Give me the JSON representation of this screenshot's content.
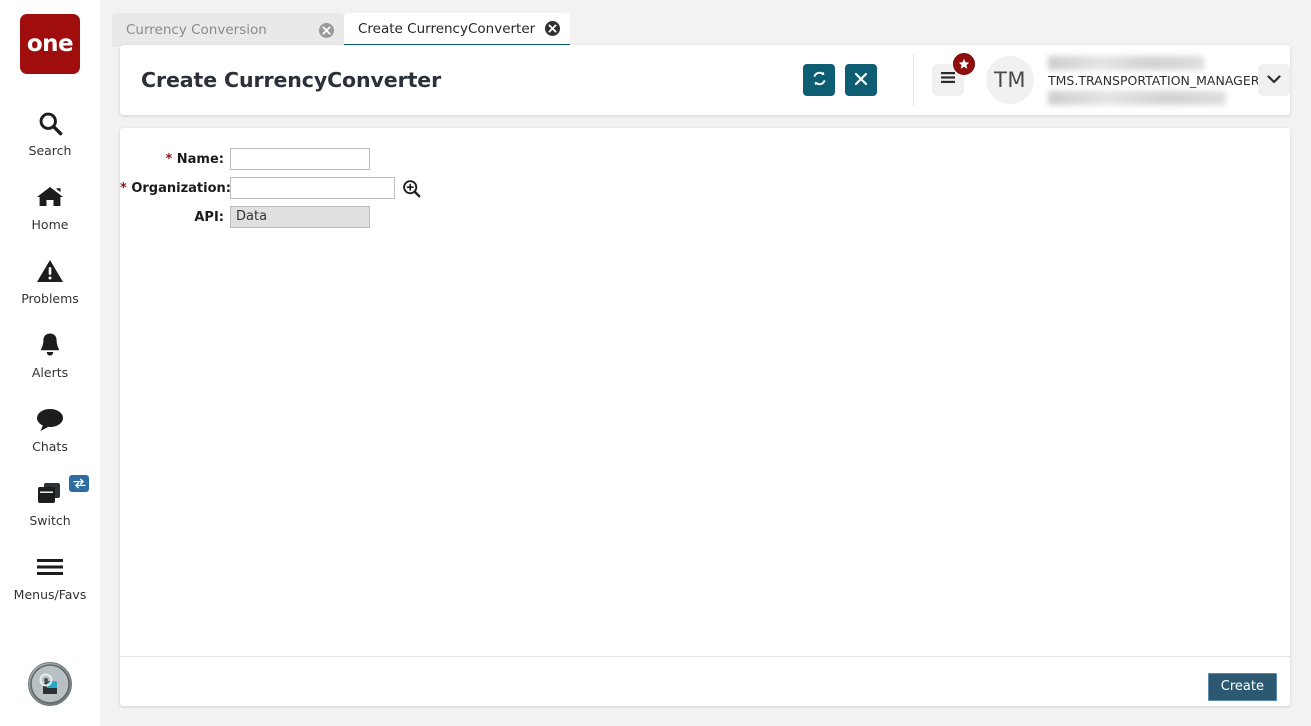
{
  "app": {
    "brand_text": "one",
    "brand_color": "#a00d0d",
    "accent_teal": "#0d5e73",
    "create_button_color": "#2c5871"
  },
  "sidebar": {
    "items": [
      {
        "label": "Search",
        "icon": "search-icon"
      },
      {
        "label": "Home",
        "icon": "home-icon"
      },
      {
        "label": "Problems",
        "icon": "warning-triangle-icon"
      },
      {
        "label": "Alerts",
        "icon": "bell-icon"
      },
      {
        "label": "Chats",
        "icon": "chat-bubble-icon"
      },
      {
        "label": "Switch",
        "icon": "switch-windows-icon",
        "badge_icon": "swap-arrows-icon"
      },
      {
        "label": "Menus/Favs",
        "icon": "hamburger-icon"
      }
    ],
    "assistant_icon": "ai-assistant-avatar-icon"
  },
  "tabs": [
    {
      "label": "Currency Conversion",
      "active": false,
      "close_icon": "close-circle-icon"
    },
    {
      "label": "Create CurrencyConverter",
      "active": true,
      "close_icon": "close-circle-icon"
    }
  ],
  "header": {
    "title": "Create CurrencyConverter",
    "refresh_icon": "refresh-sync-icon",
    "close_icon": "close-x-icon",
    "menu_icon": "hamburger-menu-icon",
    "menu_badge_icon": "star-badge-icon",
    "avatar_initials": "TM",
    "username": "TMS.TRANSPORTATION_MANAGER",
    "dropdown_icon": "chevron-down-icon"
  },
  "form": {
    "fields": [
      {
        "label": "Name:",
        "required": true,
        "type": "text",
        "value": "",
        "placeholder": ""
      },
      {
        "label": "Organization:",
        "required": true,
        "type": "text-lookup",
        "value": "",
        "placeholder": "",
        "lookup_icon": "magnifier-plus-icon"
      },
      {
        "label": "API:",
        "required": false,
        "type": "readonly",
        "value": "Data"
      }
    ]
  },
  "footer": {
    "create_label": "Create"
  }
}
